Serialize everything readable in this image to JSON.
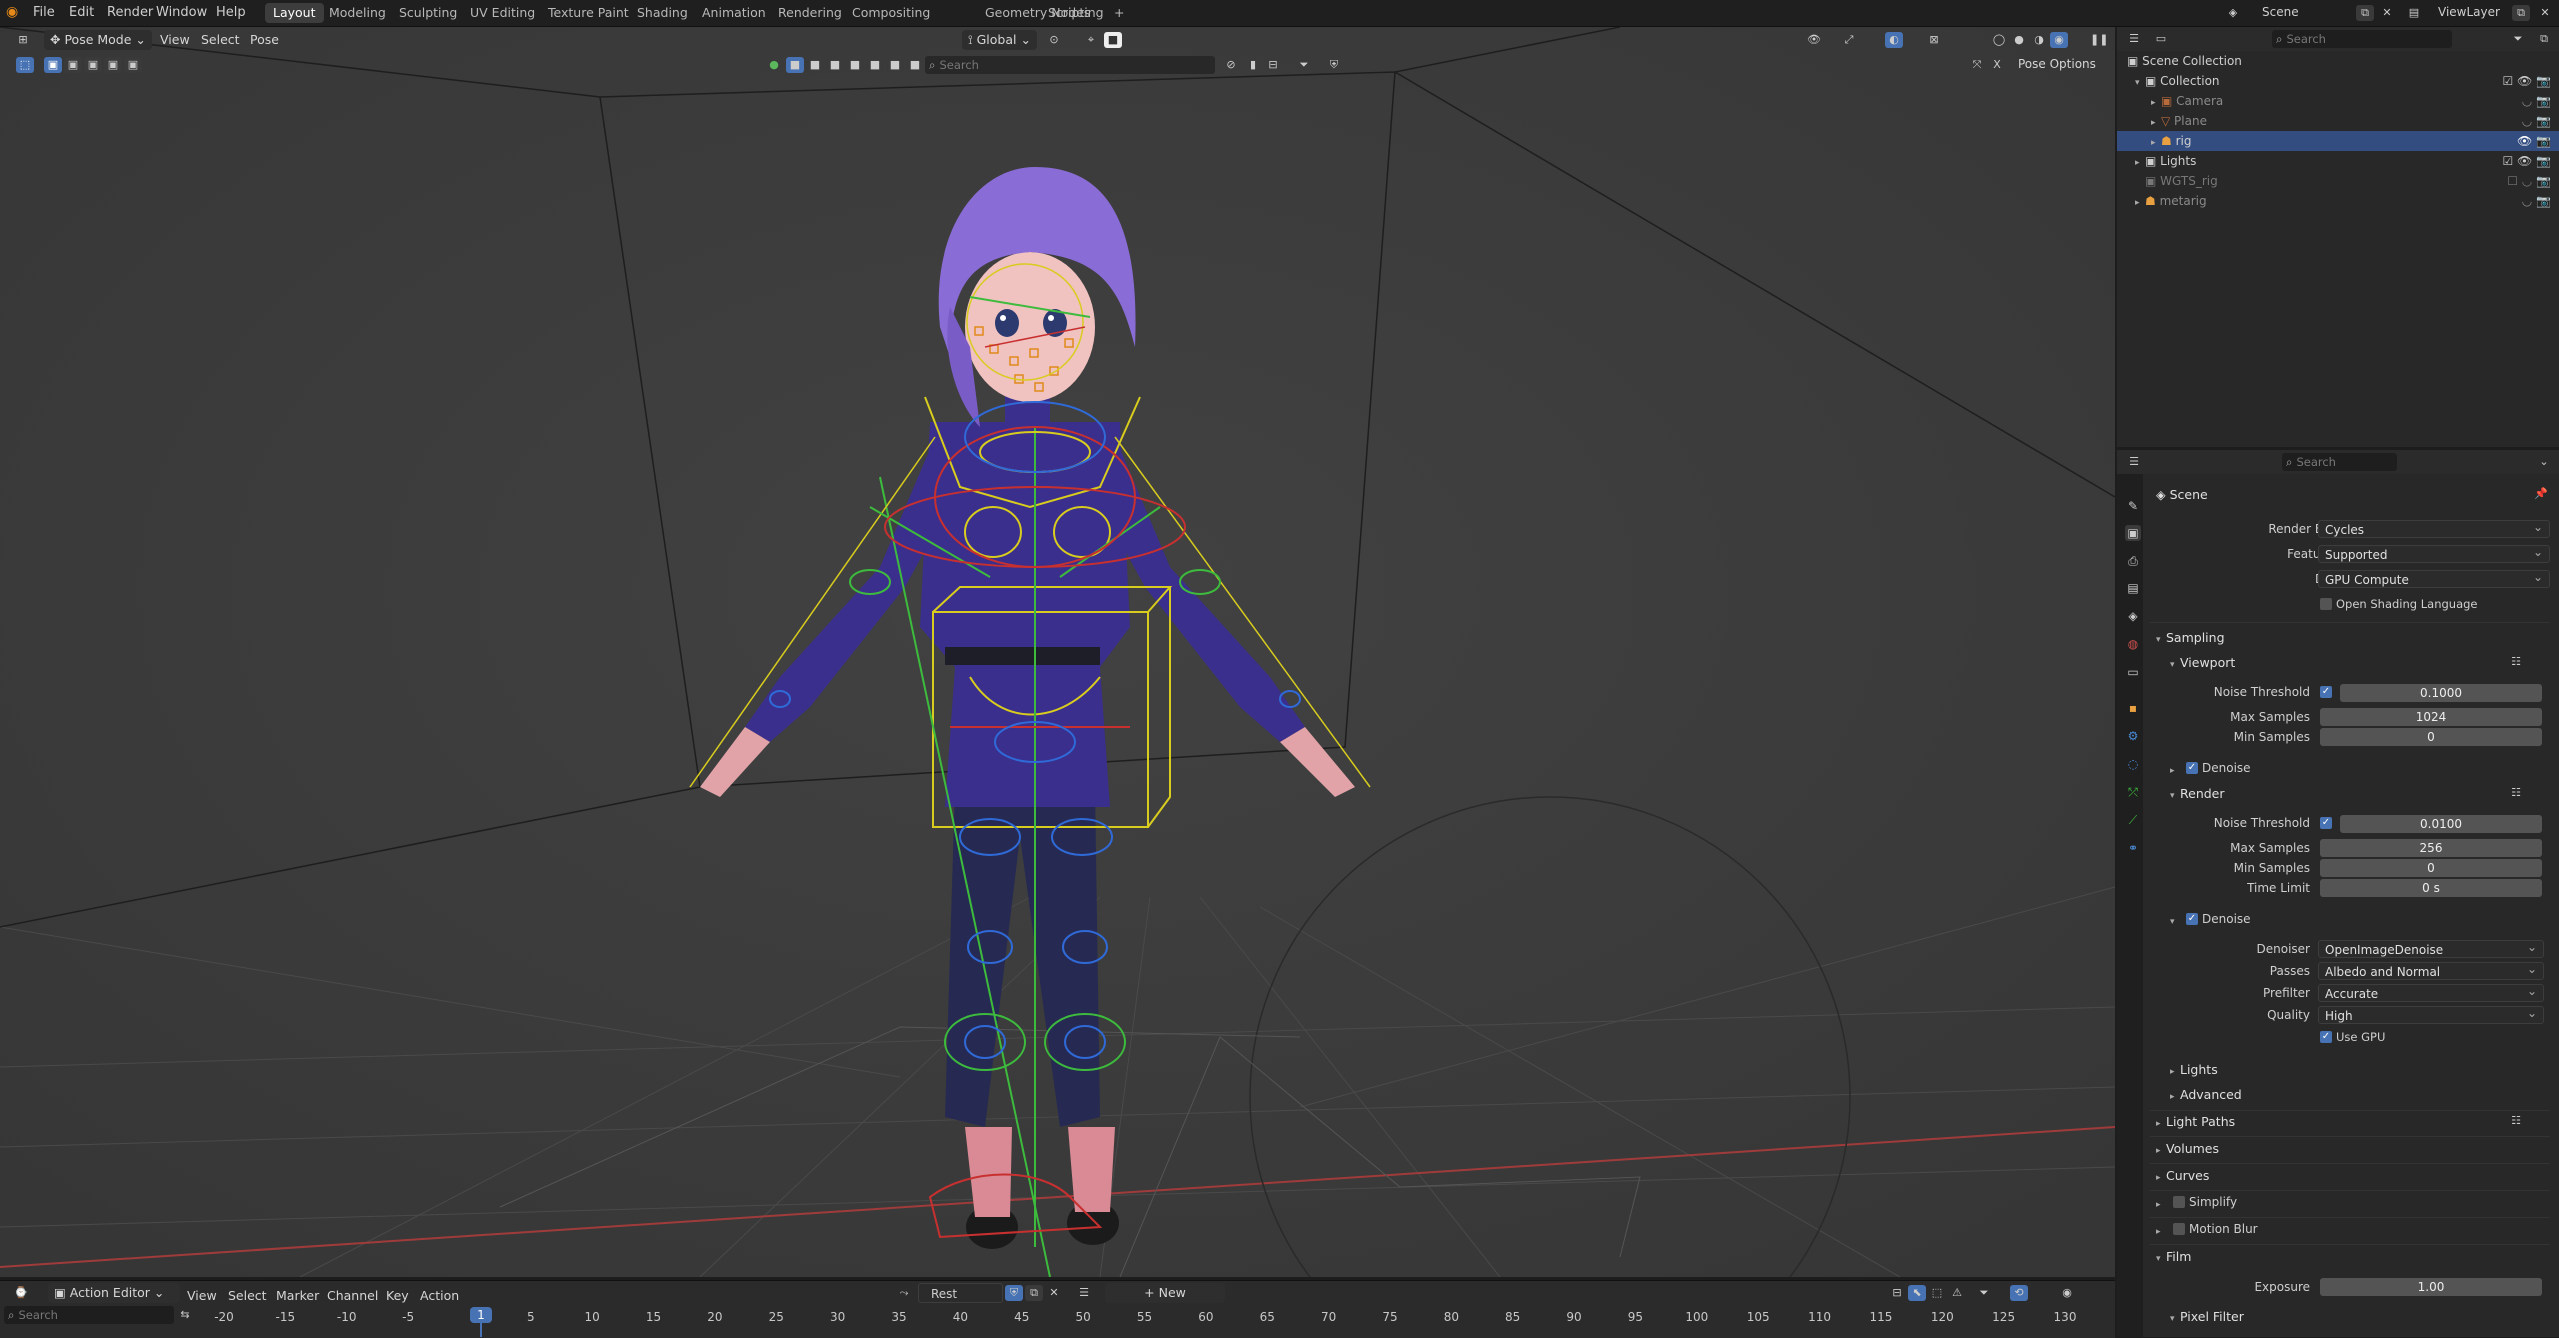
{
  "topbar": {
    "menus": [
      "File",
      "Edit",
      "Render",
      "Window",
      "Help"
    ],
    "workspaces": [
      "Layout",
      "Modeling",
      "Sculpting",
      "UV Editing",
      "Texture Paint",
      "Shading",
      "Animation",
      "Rendering",
      "Compositing",
      "Geometry Nodes",
      "Scripting"
    ],
    "active_workspace": "Layout",
    "add_tab": "+",
    "scene_name": "Scene",
    "view_layer": "ViewLayer"
  },
  "viewport": {
    "mode": "Pose Mode",
    "menus": [
      "View",
      "Select",
      "Pose"
    ],
    "transform_orientation": "Global",
    "search_placeholder": "Search",
    "pose_options": "Pose Options"
  },
  "outliner": {
    "search_placeholder": "Search",
    "rows": [
      {
        "label": "Scene Collection"
      },
      {
        "label": "Collection"
      },
      {
        "label": "Camera"
      },
      {
        "label": "Plane"
      },
      {
        "label": "rig"
      },
      {
        "label": "Lights"
      },
      {
        "label": "WGTS_rig"
      },
      {
        "label": "metarig"
      }
    ]
  },
  "properties": {
    "search_placeholder": "Search",
    "context": "Scene",
    "render_engine_label": "Render Engine",
    "render_engine": "Cycles",
    "feature_set_label": "Feature Set",
    "feature_set": "Supported",
    "device_label": "Device",
    "device": "GPU Compute",
    "osl_label": "Open Shading Language",
    "sampling": "Sampling",
    "viewport": "Viewport",
    "noise_threshold_label": "Noise Threshold",
    "vp_noise_threshold": "0.1000",
    "max_samples_label": "Max Samples",
    "vp_max_samples": "1024",
    "min_samples_label": "Min Samples",
    "vp_min_samples": "0",
    "denoise_label": "Denoise",
    "render": "Render",
    "r_noise_threshold": "0.0100",
    "r_max_samples": "256",
    "r_min_samples": "0",
    "time_limit_label": "Time Limit",
    "r_time_limit": "0 s",
    "denoiser_label": "Denoiser",
    "denoiser": "OpenImageDenoise",
    "passes_label": "Passes",
    "passes": "Albedo and Normal",
    "prefilter_label": "Prefilter",
    "prefilter": "Accurate",
    "quality_label": "Quality",
    "quality": "High",
    "use_gpu_label": "Use GPU",
    "lights": "Lights",
    "advanced": "Advanced",
    "light_paths": "Light Paths",
    "volumes": "Volumes",
    "curves": "Curves",
    "simplify": "Simplify",
    "motion_blur": "Motion Blur",
    "film": "Film",
    "exposure_label": "Exposure",
    "exposure": "1.00",
    "pixel_filter": "Pixel Filter"
  },
  "action_editor": {
    "editor": "Action Editor",
    "menus": [
      "View",
      "Select",
      "Marker",
      "Channel",
      "Key",
      "Action"
    ],
    "action_name": "Rest",
    "new_label": "New",
    "search_placeholder": "Search",
    "current_frame": "1",
    "ticks": [
      "-20",
      "-15",
      "-10",
      "-5",
      "1",
      "5",
      "10",
      "15",
      "20",
      "25",
      "30",
      "35",
      "40",
      "45",
      "50",
      "55",
      "60",
      "65",
      "70",
      "75",
      "80",
      "85",
      "90",
      "95",
      "100",
      "105",
      "110",
      "115",
      "120",
      "125",
      "130"
    ]
  },
  "colors": {
    "accent": "#4772b3",
    "selection": "#334d80",
    "viewport_bg": "#3c3c3c",
    "panel_bg": "#282828",
    "character_hair": "#8a6cd6",
    "character_shirt": "#3a2f8c",
    "bone_yellow": "#e0d020",
    "bone_green": "#40c040",
    "bone_red": "#d03030",
    "bone_blue": "#2f6ad8"
  }
}
